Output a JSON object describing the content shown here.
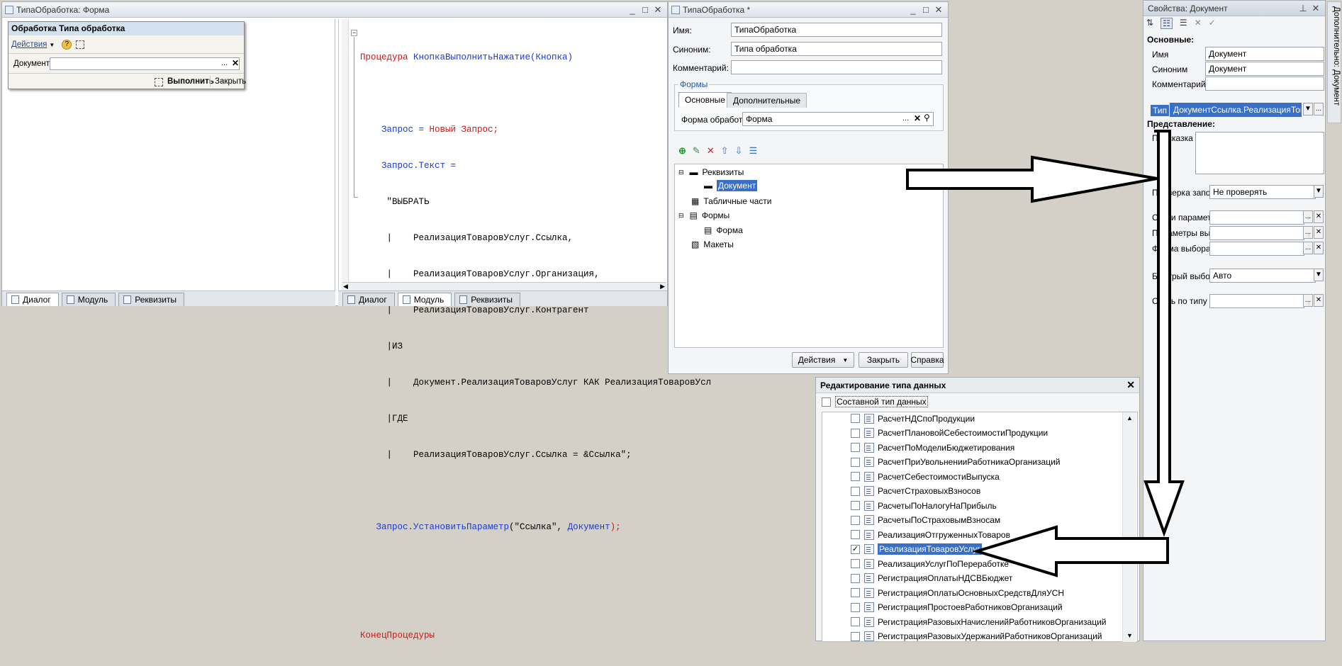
{
  "form_window": {
    "title": "ТипаОбработка: Форма",
    "form_title": "Обработка  Типа обработка",
    "actions_label": "Действия",
    "document_label": "Документ:",
    "document_value": "",
    "execute_label": "Выполнить",
    "close_label": "Закрыть",
    "tabs": [
      "Диалог",
      "Модуль",
      "Реквизиты"
    ]
  },
  "module": {
    "tabs": [
      "Диалог",
      "Модуль",
      "Реквизиты"
    ],
    "lines": [
      {
        "c": "Процедура ",
        "k": "kw"
      },
      {
        "c": "КнопкаВыполнитьНажатие",
        "k": "bl"
      },
      {
        "c": "(Кнопка)",
        "k": "bl"
      },
      {
        "c": "Запрос = ",
        "k": "bl"
      },
      {
        "c": "Новый Запрос",
        "k": "kw"
      },
      {
        "c": ";",
        "k": "kw"
      },
      {
        "c": "Запрос.Текст =",
        "k": "bl"
      },
      {
        "c": "\"ВЫБРАТЬ",
        "k": "txt"
      },
      {
        "c": "|    РеализацияТоваровУслуг.Ссылка,",
        "k": "txt"
      },
      {
        "c": "|    РеализацияТоваровУслуг.Организация,",
        "k": "txt"
      },
      {
        "c": "|    РеализацияТоваровУслуг.Контрагент",
        "k": "txt"
      },
      {
        "c": "|ИЗ",
        "k": "txt"
      },
      {
        "c": "|    Документ.РеализацияТоваровУслуг КАК РеализацияТоваровУсл",
        "k": "txt"
      },
      {
        "c": "|ГДЕ",
        "k": "txt"
      },
      {
        "c": "|    РеализацияТоваровУслуг.Ссылка = &Ссылка\";",
        "k": "txt"
      },
      {
        "c": "Запрос.УстановитьПараметр",
        "k": "bl"
      },
      {
        "c": "(\"Ссылка\", ",
        "k": "txt"
      },
      {
        "c": "Документ",
        "k": "bl"
      },
      {
        "c": ");",
        "k": "kw"
      },
      {
        "c": "КонецПроцедуры",
        "k": "kw"
      }
    ]
  },
  "processing_window": {
    "title": "ТипаОбработка *",
    "name_label": "Имя:",
    "name_value": "ТипаОбработка",
    "synonym_label": "Синоним:",
    "synonym_value": "Типа обработка",
    "comment_label": "Комментарий:",
    "comment_value": "",
    "forms_group": "Формы",
    "tab_main": "Основные",
    "tab_extra": "Дополнительные",
    "processing_form_label": "Форма обработки:",
    "processing_form_value": "Форма",
    "tree": [
      "Реквизиты",
      "Документ",
      "Табличные части",
      "Формы",
      "Форма",
      "Макеты"
    ],
    "actions_button": "Действия",
    "close_button": "Закрыть",
    "help_button": "Справка"
  },
  "type_editor": {
    "title": "Редактирование типа данных",
    "composite_label": "Составной тип данных",
    "items": [
      {
        "name": "РасчетНДСпоПродукции",
        "checked": false
      },
      {
        "name": "РасчетПлановойСебестоимостиПродукции",
        "checked": false
      },
      {
        "name": "РасчетПоМоделиБюджетирования",
        "checked": false
      },
      {
        "name": "РасчетПриУвольненииРаботникаОрганизаций",
        "checked": false
      },
      {
        "name": "РасчетСебестоимостиВыпуска",
        "checked": false
      },
      {
        "name": "РасчетСтраховыхВзносов",
        "checked": false
      },
      {
        "name": "РасчетыПоНалогуНаПрибыль",
        "checked": false
      },
      {
        "name": "РасчетыПоСтраховымВзносам",
        "checked": false
      },
      {
        "name": "РеализацияОтгруженныхТоваров",
        "checked": false
      },
      {
        "name": "РеализацияТоваровУслуг",
        "checked": true
      },
      {
        "name": "РеализацияУслугПоПереработке",
        "checked": false
      },
      {
        "name": "РегистрацияОплатыНДСВБюджет",
        "checked": false
      },
      {
        "name": "РегистрацияОплатыОсновныхСредствДляУСН",
        "checked": false
      },
      {
        "name": "РегистрацияПростоевРаботниковОрганизаций",
        "checked": false
      },
      {
        "name": "РегистрацияРазовыхНачисленийРаботниковОрганизаций",
        "checked": false
      },
      {
        "name": "РегистрацияРазовыхУдержанийРаботниковОрганизаций",
        "checked": false
      }
    ]
  },
  "properties": {
    "title": "Свойства: Документ",
    "side_tab": "Дополнительно: Документ",
    "section_main": "Основные:",
    "name_label": "Имя",
    "name_value": "Документ",
    "synonym_label": "Синоним",
    "synonym_value": "Документ",
    "comment_label": "Комментарий",
    "type_label": "Тип",
    "type_value": "ДокументСсылка.РеализацияТоваро",
    "section_view": "Представление:",
    "hint_label": "Подсказка",
    "fill_check_label": "Проверка запо",
    "fill_check_value": "Не проверять",
    "param_link_label": "Связи парамет",
    "params_label": "Параметры выб",
    "choice_form_label": "Форма выбора",
    "quick_choice_label": "Быстрый выбор",
    "quick_choice_value": "Авто",
    "type_link_label": "Связь по типу"
  }
}
